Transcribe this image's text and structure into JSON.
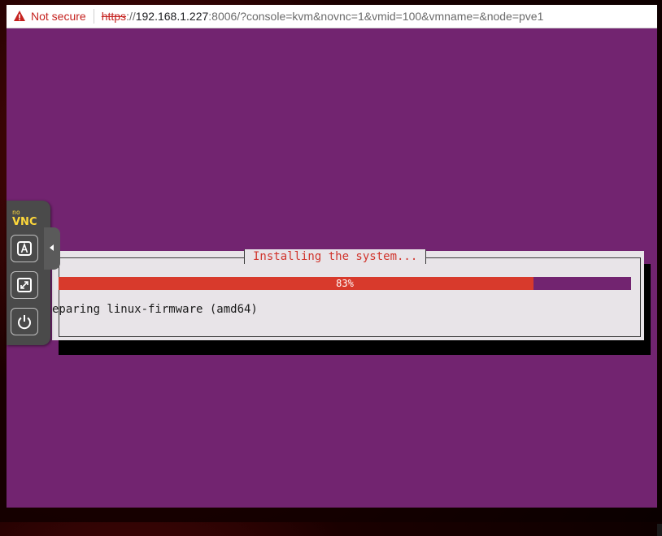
{
  "browser": {
    "security_label": "Not secure",
    "url_scheme": "https",
    "url_scheme_sep": "://",
    "url_host": "192.168.1.227",
    "url_rest": ":8006/?console=kvm&novnc=1&vmid=100&vmname=&node=pve1"
  },
  "installer": {
    "dialog_title": "Installing the system...",
    "progress_percent": 83,
    "progress_label": "83%",
    "status_text": "eparing linux-firmware (amd64)"
  },
  "vnc_panel": {
    "logo_text": "VNC",
    "buttons": [
      {
        "icon": "keyboard-a-icon",
        "name": "extra-keys-button"
      },
      {
        "icon": "fullscreen-icon",
        "name": "fullscreen-button"
      },
      {
        "icon": "power-icon",
        "name": "power-button"
      }
    ]
  },
  "colors": {
    "console_bg": "#722470",
    "progress_fill": "#d83a2c",
    "dialog_bg": "#e8e4e8",
    "title_text": "#d0342c"
  }
}
